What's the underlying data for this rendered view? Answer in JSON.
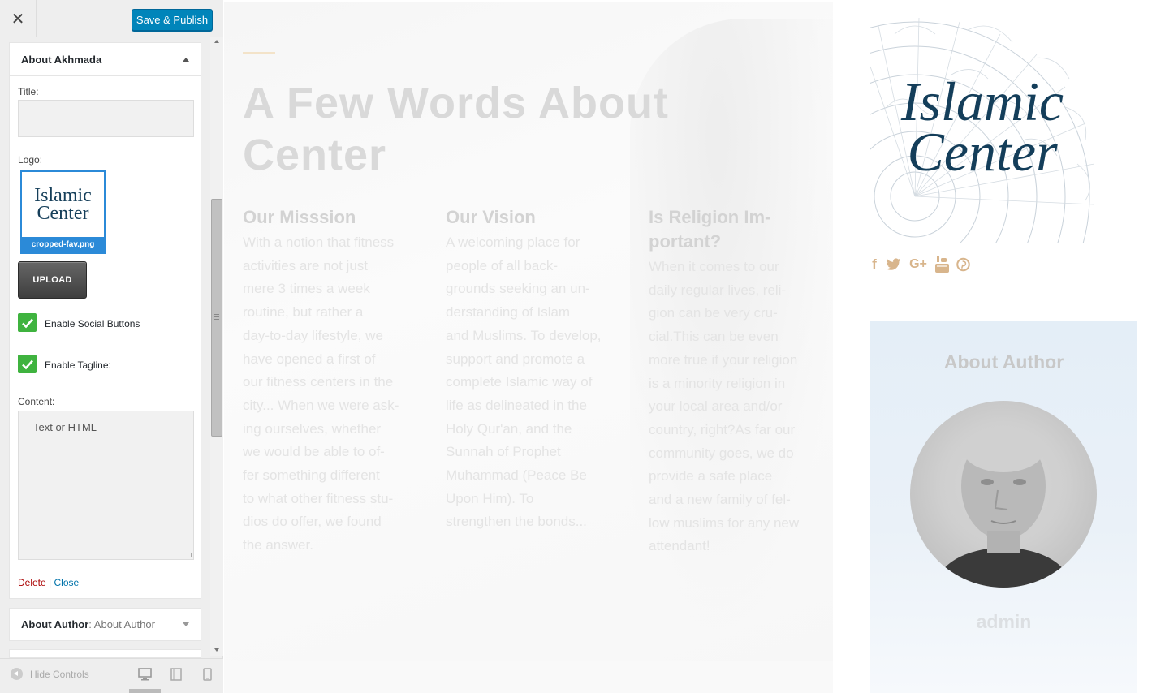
{
  "topbar": {
    "close_glyph": "✕",
    "publish_label": "Save & Publish"
  },
  "widget_open": {
    "title": "About Akhmada",
    "title_label": "Title:",
    "title_value": "",
    "logo_label": "Logo:",
    "logo_filename": "cropped-fav.png",
    "logo_text_line1": "Islamic",
    "logo_text_line2": "Center",
    "upload_label": "UPLOAD",
    "social_label": "Enable Social Buttons",
    "social_checked": true,
    "tagline_label": "Enable Tagline:",
    "tagline_checked": true,
    "content_label": "Content:",
    "content_placeholder": "Text or HTML",
    "delete_label": "Delete",
    "separator": "|",
    "close_label": "Close"
  },
  "widget_collapsed": {
    "title": "About Author",
    "subtitle": ": About Author"
  },
  "footer": {
    "hide_controls": "Hide Controls"
  },
  "preview": {
    "heading_line1": "A Few Words About",
    "heading_line2": "Center",
    "columns": [
      {
        "title": "Our Misssion",
        "lines": [
          "With a notion that fitness",
          "activities are not just",
          "mere 3 times a week",
          "routine, but rather a",
          "day-to-day lifestyle, we",
          "have opened a first of",
          "our fitness centers in the",
          "city... When we were ask-",
          "ing ourselves, whether",
          "we would be able to of-",
          "fer something different",
          "to what other fitness stu-",
          "dios do offer, we found",
          "the answer."
        ]
      },
      {
        "title": "Our Vision",
        "lines": [
          "A welcoming place for",
          "people of all back-",
          "grounds seeking an un-",
          "derstanding of Islam",
          "and Muslims. To develop,",
          "support and promote a",
          "complete Islamic way of",
          "life as delineated in the",
          "Holy Qur'an, and the",
          "Sunnah of Prophet",
          "Muhammad (Peace Be",
          "Upon Him). To",
          "strengthen the bonds..."
        ]
      },
      {
        "title_line1": "Is Religion Im-",
        "title_line2": "portant?",
        "lines": [
          "When it comes to our",
          "daily regular lives, reli-",
          "gion can be very cru-",
          "cial.This can be even",
          "more true if your religion",
          "is a minority religion in",
          "your local area and/or",
          "country, right?As far our",
          "community goes, we do",
          "provide a safe place",
          "and a new family of fel-",
          "low muslims for any new",
          "attendant!"
        ]
      }
    ],
    "logo_line1": "Islamic",
    "logo_line2": "Center",
    "social_icons": [
      "facebook-icon",
      "twitter-icon",
      "google-plus-icon",
      "youtube-icon",
      "pinterest-icon"
    ],
    "social_glyphs": [
      "f",
      "🐦",
      "G+",
      "▶",
      "ⓟ"
    ],
    "author_title": "About Author",
    "author_name": "admin"
  },
  "colors": {
    "publish_blue": "#0085ba",
    "checkbox_green": "#3fb33f",
    "delete_red": "#aa0000",
    "link_blue": "#0073aa",
    "social_gold": "#d8b58c",
    "logo_navy": "#143e5a"
  }
}
